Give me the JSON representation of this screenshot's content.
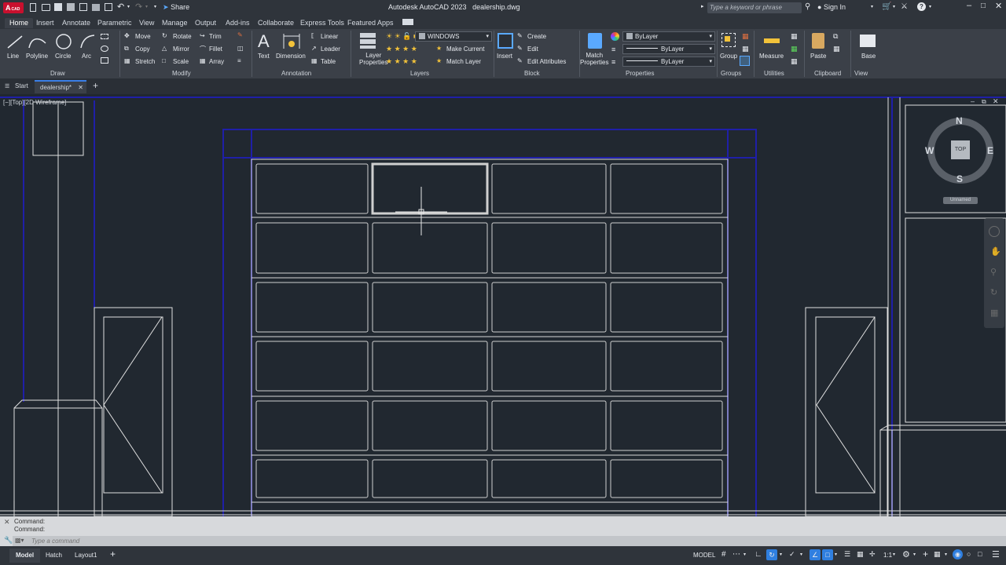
{
  "app": {
    "title": "Autodesk AutoCAD 2023",
    "filename": "dealership.dwg",
    "logo_text": "A",
    "logo_sub": "CAD",
    "share_label": "Share",
    "search_placeholder": "Type a keyword or phrase",
    "sign_in": "Sign In"
  },
  "ribbon_tabs": [
    "Home",
    "Insert",
    "Annotate",
    "Parametric",
    "View",
    "Manage",
    "Output",
    "Add-ins",
    "Collaborate",
    "Express Tools",
    "Featured Apps"
  ],
  "ribbon": {
    "draw": {
      "title": "Draw",
      "tools": [
        "Line",
        "Polyline",
        "Circle",
        "Arc"
      ]
    },
    "modify": {
      "title": "Modify",
      "rows": [
        [
          "Move",
          "Rotate",
          "Trim"
        ],
        [
          "Copy",
          "Mirror",
          "Fillet"
        ],
        [
          "Stretch",
          "Scale",
          "Array"
        ]
      ]
    },
    "annotation": {
      "title": "Annotation",
      "big": [
        "Text",
        "Dimension"
      ],
      "small": [
        "Linear",
        "Leader",
        "Table"
      ]
    },
    "layers": {
      "title": "Layers",
      "big": "Layer Properties",
      "layer_name": "WINDOWS",
      "small": [
        "Make Current",
        "Match Layer"
      ]
    },
    "block": {
      "title": "Block",
      "big": "Insert",
      "small": [
        "Create",
        "Edit",
        "Edit Attributes"
      ]
    },
    "properties": {
      "title": "Properties",
      "big": "Match Properties",
      "color": "ByLayer",
      "linetype": "ByLayer",
      "lineweight": "ByLayer"
    },
    "groups": {
      "title": "Groups",
      "big": "Group"
    },
    "utilities": {
      "title": "Utilities",
      "big": "Measure"
    },
    "clipboard": {
      "title": "Clipboard",
      "big": "Paste"
    },
    "view": {
      "title": "View",
      "big": "Base"
    }
  },
  "doc_tabs": {
    "start": "Start",
    "active": "dealership*"
  },
  "viewport": {
    "label": "[−][Top][2D Wireframe]",
    "viewcube": {
      "n": "N",
      "s": "S",
      "e": "E",
      "w": "W",
      "top": "TOP",
      "ucs": "Unnamed"
    }
  },
  "command": {
    "history": [
      "Command:",
      "Command:"
    ],
    "placeholder": "Type a command"
  },
  "status": {
    "layout_tabs": [
      "Model",
      "Hatch",
      "Layout1"
    ],
    "model": "MODEL",
    "scale": "1:1"
  },
  "colors": {
    "drawing_bg": "#212830",
    "line_white": "#e8e8e8",
    "line_blue": "#1f1fa8",
    "ribbon": "#3b4048",
    "accent": "#2f7fe0"
  }
}
